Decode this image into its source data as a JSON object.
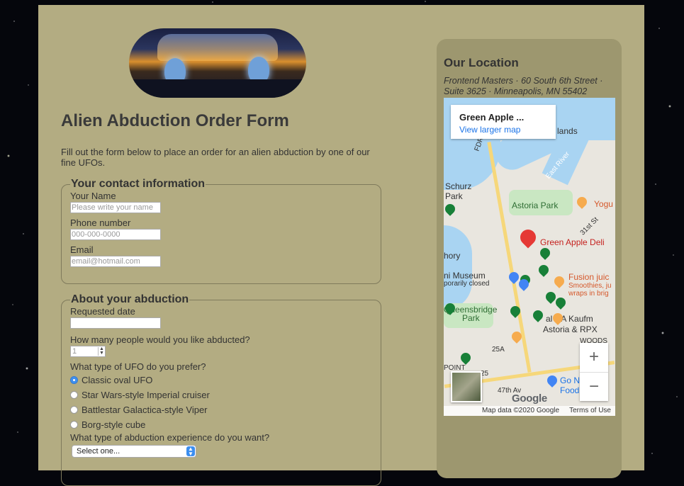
{
  "form": {
    "title": "Alien Abduction Order Form",
    "intro": "Fill out the form below to place an order for an alien abduction by one of our fine UFOs.",
    "contact": {
      "legend": "Your contact information",
      "name_label": "Your Name",
      "name_placeholder": "Please write your name",
      "phone_label": "Phone number",
      "phone_placeholder": "000-000-0000",
      "email_label": "Email",
      "email_placeholder": "email@hotmail.com"
    },
    "abduction": {
      "legend": "About your abduction",
      "date_label": "Requested date",
      "people_label": "How many people would you like abducted?",
      "people_value": "1",
      "ufo_label": "What type of UFO do you prefer?",
      "ufo_options": [
        {
          "label": "Classic oval UFO",
          "selected": true
        },
        {
          "label": "Star Wars-style Imperial cruiser",
          "selected": false
        },
        {
          "label": "Battlestar Galactica-style Viper",
          "selected": false
        },
        {
          "label": "Borg-style cube",
          "selected": false
        }
      ],
      "experience_label": "What type of abduction experience do you want?",
      "experience_selected": "Select one..."
    }
  },
  "location": {
    "title": "Our Location",
    "address": "Frontend Masters · 60 South 6th Street · Suite 3625 · Minneapolis, MN 55402",
    "map": {
      "place_name": "Green Apple ...",
      "larger_map_link": "View larger map",
      "labels": {
        "schurz": "Schurz",
        "park": "Park",
        "astoria_park": "Astoria Park",
        "yogu": "Yogu",
        "green_apple": "Green Apple Deli",
        "museum": "ni Museum",
        "closed": "porarily closed",
        "fusion": "Fusion juic",
        "smoothies": "Smoothies, ju",
        "wraps": "wraps in brig",
        "queensbridge": "Queensbridge",
        "qb_park": "Park",
        "ua": "al UA Kaufm",
        "astoria_rpx": "Astoria & RPX",
        "woods": "WOODS",
        "point": "POINT",
        "go_h": "Go N H",
        "food": "Food",
        "east_river": "East River",
        "lands": "lands",
        "fdr": "FDR",
        "hory": "hory",
        "rt_25a": "25A",
        "rt_25": "25",
        "st_31": "31st St",
        "st_47": "47th Av"
      },
      "zoom_in": "+",
      "zoom_out": "−",
      "logo": "Google",
      "data_credit": "Map data ©2020 Google",
      "terms": "Terms of Use"
    }
  }
}
